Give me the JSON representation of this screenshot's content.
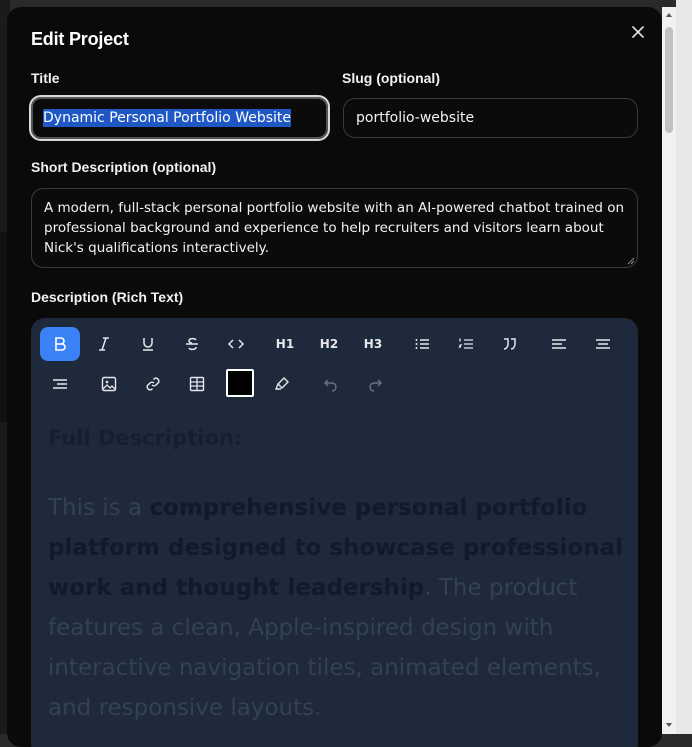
{
  "modal": {
    "title": "Edit Project"
  },
  "fields": {
    "title_label": "Title",
    "title_value": "Dynamic Personal Portfolio Website",
    "slug_label": "Slug (optional)",
    "slug_value": "portfolio-website",
    "short_desc_label": "Short Description (optional)",
    "short_desc_value": "A modern, full-stack personal portfolio website with an AI-powered chatbot trained on professional background and experience to help recruiters and visitors learn about Nick's qualifications interactively.",
    "description_label": "Description (Rich Text)"
  },
  "toolbar": {
    "h1": "H1",
    "h2": "H2",
    "h3": "H3",
    "text_color": "#000000",
    "active_color": "#3b82f6"
  },
  "editor": {
    "heading": "Full Description:",
    "p_intro": "This is a ",
    "p_bold": "comprehensive personal portfolio platform designed to showcase professional work and thought leadership",
    "p_rest": ". The product features a clean, Apple-inspired design with interactive navigation tiles, animated elements, and responsive layouts."
  }
}
